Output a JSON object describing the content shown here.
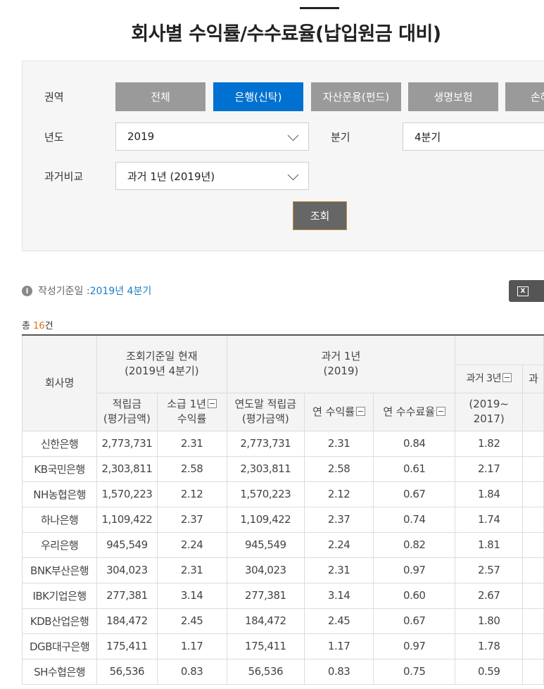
{
  "title": "회사별 수익률/수수료율(납입원금 대비)",
  "filters": {
    "region_label": "권역",
    "region_buttons": [
      "전체",
      "은행(신탁)",
      "자산운용(펀드)",
      "생명보험",
      "손해"
    ],
    "year_label": "년도",
    "year_value": "2019",
    "quarter_label": "분기",
    "quarter_value": "4분기",
    "compare_label": "과거비교",
    "compare_value": "과거 1년 (2019년)",
    "query_button": "조회"
  },
  "info": {
    "label": "작성기준일 : ",
    "value": "2019년 4분기"
  },
  "total": {
    "prefix": "총 ",
    "count": "16",
    "suffix": "건"
  },
  "table": {
    "h_company": "회사명",
    "h_current": "조회기준일 현재\n(2019년 4분기)",
    "h_past1": "과거 1년\n(2019)",
    "h_past3": "과거 3년",
    "h_past_more": "과",
    "sub": {
      "reserve": "적립금\n(평가금액)",
      "since1": "소급 1년",
      "since1_b": "수익률",
      "yearend": "연도말 적립금\n(평가금액)",
      "annual_return": "연 수익률",
      "annual_fee": "연 수수료율",
      "p3_range": "(2019~\n2017)"
    },
    "rows": [
      [
        "신한은행",
        "2,773,731",
        "2.31",
        "2,773,731",
        "2.31",
        "0.84",
        "1.82"
      ],
      [
        "KB국민은행",
        "2,303,811",
        "2.58",
        "2,303,811",
        "2.58",
        "0.61",
        "2.17"
      ],
      [
        "NH농협은행",
        "1,570,223",
        "2.12",
        "1,570,223",
        "2.12",
        "0.67",
        "1.84"
      ],
      [
        "하나은행",
        "1,109,422",
        "2.37",
        "1,109,422",
        "2.37",
        "0.74",
        "1.74"
      ],
      [
        "우리은행",
        "945,549",
        "2.24",
        "945,549",
        "2.24",
        "0.82",
        "1.81"
      ],
      [
        "BNK부산은행",
        "304,023",
        "2.31",
        "304,023",
        "2.31",
        "0.97",
        "2.57"
      ],
      [
        "IBK기업은행",
        "277,381",
        "3.14",
        "277,381",
        "3.14",
        "0.60",
        "2.67"
      ],
      [
        "KDB산업은행",
        "184,472",
        "2.45",
        "184,472",
        "2.45",
        "0.67",
        "1.80"
      ],
      [
        "DGB대구은행",
        "175,411",
        "1.17",
        "175,411",
        "1.17",
        "0.97",
        "1.78"
      ],
      [
        "SH수협은행",
        "56,536",
        "0.83",
        "56,536",
        "0.83",
        "0.75",
        "0.59"
      ]
    ]
  }
}
